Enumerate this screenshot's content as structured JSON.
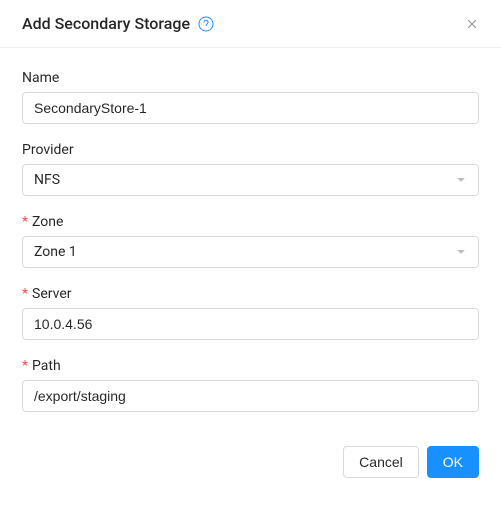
{
  "header": {
    "title": "Add Secondary Storage"
  },
  "form": {
    "name": {
      "label": "Name",
      "value": "SecondaryStore-1",
      "required": false
    },
    "provider": {
      "label": "Provider",
      "value": "NFS",
      "required": false
    },
    "zone": {
      "label": "Zone",
      "value": "Zone 1",
      "required": true
    },
    "server": {
      "label": "Server",
      "value": "10.0.4.56",
      "required": true
    },
    "path": {
      "label": "Path",
      "value": "/export/staging",
      "required": true
    }
  },
  "footer": {
    "cancel": "Cancel",
    "ok": "OK"
  },
  "marks": {
    "required": "*"
  }
}
